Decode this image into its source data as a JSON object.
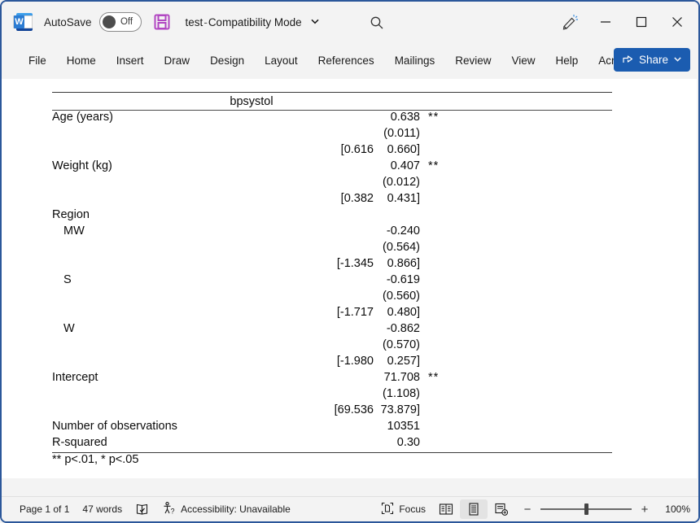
{
  "titlebar": {
    "app_icon": "word-icon",
    "autosave_label": "AutoSave",
    "autosave_state": "Off",
    "save_icon": "save-icon",
    "doc_name": "test",
    "separator": "-",
    "doc_mode": "Compatibility Mode",
    "title_chevron": "chevron-down-icon",
    "search_icon": "search-icon",
    "pen_icon": "pen-draw-icon",
    "minimize": "minimize-icon",
    "maximize": "maximize-icon",
    "close": "close-icon"
  },
  "ribbon": {
    "tabs": [
      {
        "label": "File"
      },
      {
        "label": "Home"
      },
      {
        "label": "Insert"
      },
      {
        "label": "Draw"
      },
      {
        "label": "Design"
      },
      {
        "label": "Layout"
      },
      {
        "label": "References"
      },
      {
        "label": "Mailings"
      },
      {
        "label": "Review"
      },
      {
        "label": "View"
      },
      {
        "label": "Help"
      },
      {
        "label": "Acrobat"
      }
    ],
    "share_label": "Share",
    "share_chevron": "chevron-down-icon",
    "share_color": "#1b5cb0"
  },
  "document": {
    "table": {
      "dependent_variable": "bpsystol",
      "rows": [
        {
          "label": "Age (years)",
          "indent": false,
          "coef": "0.638",
          "stars": "**",
          "se": "(0.011)",
          "ci_lo": "[0.616",
          "ci_hi": "0.660]"
        },
        {
          "label": "Weight (kg)",
          "indent": false,
          "coef": "0.407",
          "stars": "**",
          "se": "(0.012)",
          "ci_lo": "[0.382",
          "ci_hi": "0.431]"
        }
      ],
      "group_label": "Region",
      "group_rows": [
        {
          "label": "MW",
          "indent": true,
          "coef": "-0.240",
          "stars": "",
          "se": "(0.564)",
          "ci_lo": "[-1.345",
          "ci_hi": "0.866]"
        },
        {
          "label": "S",
          "indent": true,
          "coef": "-0.619",
          "stars": "",
          "se": "(0.560)",
          "ci_lo": "[-1.717",
          "ci_hi": "0.480]"
        },
        {
          "label": "W",
          "indent": true,
          "coef": "-0.862",
          "stars": "",
          "se": "(0.570)",
          "ci_lo": "[-1.980",
          "ci_hi": "0.257]"
        }
      ],
      "intercept": {
        "label": "Intercept",
        "coef": "71.708",
        "stars": "**",
        "se": "(1.108)",
        "ci_lo": "[69.536",
        "ci_hi": "73.879]"
      },
      "stats": [
        {
          "label": "Number of observations",
          "value": "10351"
        },
        {
          "label": "R-squared",
          "value": "0.30"
        }
      ],
      "footnote": "** p<.01, * p<.05"
    }
  },
  "statusbar": {
    "page_indicator": "Page 1 of 1",
    "word_count": "47 words",
    "proofing_icon": "proofing-check-icon",
    "accessibility_icon": "accessibility-icon",
    "accessibility_label": "Accessibility: Unavailable",
    "focus_icon": "focus-icon",
    "focus_label": "Focus",
    "view_read": "read-mode-icon",
    "view_print": "print-layout-icon",
    "view_web": "web-layout-icon",
    "zoom_out": "−",
    "zoom_in": "+",
    "zoom_level": "100%"
  }
}
